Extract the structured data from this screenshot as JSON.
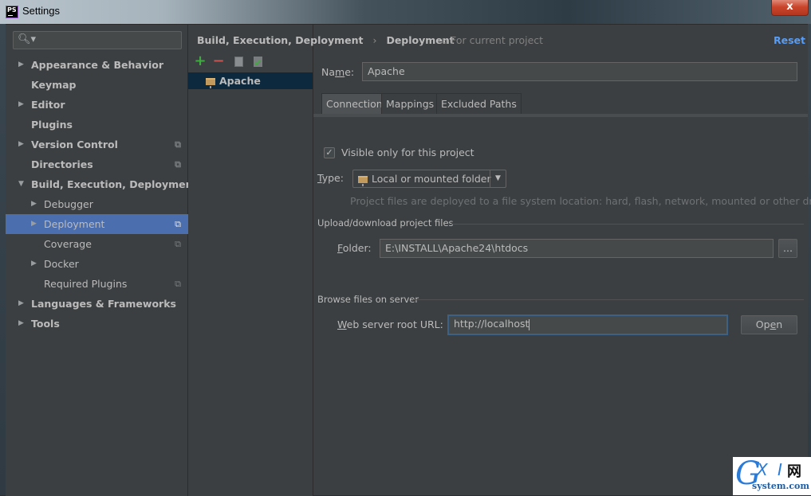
{
  "window": {
    "title": "Settings",
    "app_icon_label": "PS",
    "close_label": "x"
  },
  "sidebar": {
    "search_placeholder": "",
    "items": [
      {
        "label": "Appearance & Behavior",
        "level": 0,
        "arrow": "right",
        "project": false
      },
      {
        "label": "Keymap",
        "level": 0,
        "arrow": "none",
        "project": false
      },
      {
        "label": "Editor",
        "level": 0,
        "arrow": "right",
        "project": false
      },
      {
        "label": "Plugins",
        "level": 0,
        "arrow": "none",
        "project": false
      },
      {
        "label": "Version Control",
        "level": 0,
        "arrow": "right",
        "project": true
      },
      {
        "label": "Directories",
        "level": 0,
        "arrow": "none",
        "project": true
      },
      {
        "label": "Build, Execution, Deployment",
        "level": 0,
        "arrow": "down",
        "project": false
      },
      {
        "label": "Debugger",
        "level": 1,
        "arrow": "right",
        "project": false
      },
      {
        "label": "Deployment",
        "level": 1,
        "arrow": "right",
        "project": true,
        "selected": true
      },
      {
        "label": "Coverage",
        "level": 1,
        "arrow": "none",
        "project": true
      },
      {
        "label": "Docker",
        "level": 1,
        "arrow": "right",
        "project": false
      },
      {
        "label": "Required Plugins",
        "level": 1,
        "arrow": "none",
        "project": true
      },
      {
        "label": "Languages & Frameworks",
        "level": 0,
        "arrow": "right",
        "project": false
      },
      {
        "label": "Tools",
        "level": 0,
        "arrow": "right",
        "project": false
      }
    ]
  },
  "header": {
    "breadcrumb": [
      "Build, Execution, Deployment",
      "Deployment"
    ],
    "separator": "›",
    "scope": "For current project",
    "reset_label": "Reset"
  },
  "servers": {
    "toolbar": {
      "add": "+",
      "remove": "−",
      "copy": "copy",
      "check": "check"
    },
    "items": [
      {
        "label": "Apache",
        "selected": true
      }
    ]
  },
  "form": {
    "name_label": "Name:",
    "name_value": "Apache",
    "tabs": [
      {
        "label": "Connection",
        "active": true
      },
      {
        "label": "Mappings",
        "active": false
      },
      {
        "label": "Excluded Paths",
        "active": false
      }
    ],
    "visible_only_label": "Visible only for this project",
    "visible_only_checked": true,
    "type_label": "Type:",
    "type_value": "Local or mounted folder",
    "type_hint": "Project files are deployed to a file system location: hard, flash, network, mounted or other drive.",
    "upload_section": "Upload/download project files",
    "folder_label": "Folder:",
    "folder_value": "E:\\INSTALL\\Apache24\\htdocs",
    "browse_label": "...",
    "browse_section": "Browse files on server",
    "url_label": "Web server root URL:",
    "url_value": "http://localhost",
    "open_label": "Open"
  },
  "watermark": {
    "g": "G",
    "xi": "X I",
    "cn": "网",
    "site": "system.com"
  },
  "colors": {
    "accent_link": "#589df6",
    "selection": "#4b6eaf",
    "list_selection": "#0d293e",
    "add_green": "#3eab3e",
    "remove_red": "#c75450"
  }
}
